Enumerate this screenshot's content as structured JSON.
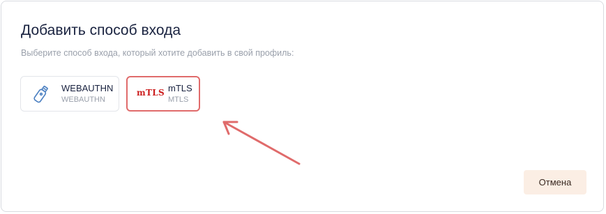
{
  "dialog": {
    "title": "Добавить способ входа",
    "subtitle": "Выберите способ входа, который хотите добавить в свой профиль:"
  },
  "methods": [
    {
      "name": "WEBAUTHN",
      "type": "WEBAUTHN",
      "icon": "usb-key-icon"
    },
    {
      "name": "mTLS",
      "type": "MTLS",
      "logo": "mTLS",
      "selected": true
    }
  ],
  "cancel_label": "Отмена",
  "colors": {
    "highlight": "#e06b6b",
    "mtls_logo": "#cc1f1f",
    "cancel_bg": "#fbeee4"
  }
}
